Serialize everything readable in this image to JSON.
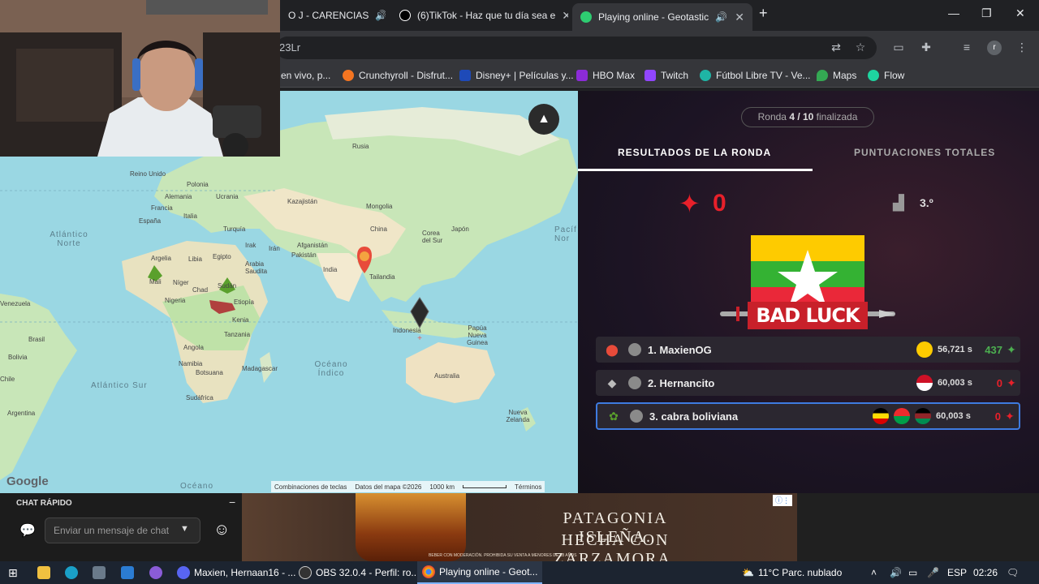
{
  "browser": {
    "tabs": [
      {
        "title": "O J - CARENCIAS",
        "icon": "youtube-tab-icon"
      },
      {
        "title": "(6)TikTok - Haz que tu día sea e",
        "icon": "tiktok-icon"
      },
      {
        "title": "Playing online - Geotastic",
        "icon": "geotastic-icon"
      }
    ],
    "new_tab": "+",
    "url": "23Lr",
    "bookmarks": [
      "en vivo, p...",
      "Crunchyroll - Disfrut...",
      "Disney+ | Películas y...",
      "HBO Max",
      "Twitch",
      "Fútbol Libre TV - Ve...",
      "Maps",
      "Flow"
    ],
    "bookmark_colors": [
      "#777777",
      "#f47521",
      "#1e4ab8",
      "#8c2bd8",
      "#9146ff",
      "#1fb5a5",
      "#34a853",
      "#1ed5a0"
    ]
  },
  "map": {
    "countries": [
      "Rusia",
      "Reino Unido",
      "Polonia",
      "Alemania",
      "Ucrania",
      "Francia",
      "España",
      "Italia",
      "Kazajistán",
      "Mongolia",
      "Turquía",
      "Irak",
      "Irán",
      "China",
      "Corea del Sur",
      "Japón",
      "Afganistán",
      "Pakistán",
      "India",
      "Arabia Saudita",
      "Argelia",
      "Libia",
      "Egipto",
      "Mali",
      "Níger",
      "Chad",
      "Sudán",
      "Nigeria",
      "Etiopía",
      "Kenia",
      "Tanzania",
      "Angola",
      "Namibia",
      "Botsuana",
      "Madagascar",
      "Sudáfrica",
      "Venezuela",
      "Brasil",
      "Bolivia",
      "Chile",
      "Argentina",
      "Indonesia",
      "Papúa Nueva Guinea",
      "Australia",
      "Nueva Zelanda",
      "Tailandia"
    ],
    "oceans": [
      "Atlántico Norte",
      "Atlántico Sur",
      "Océano Índico",
      "Océano",
      "Pacíf Nor"
    ],
    "footer": [
      "Combinaciones de teclas",
      "Datos del mapa ©2026",
      "1000 km",
      "Términos"
    ],
    "logo": "Google"
  },
  "game": {
    "round_prefix": "Ronda ",
    "round_bold": "4 / 10",
    "round_suffix": " finalizada",
    "tabs": [
      "RESULTADOS DE LA RONDA",
      "PUNTUACIONES TOTALES"
    ],
    "score": "0",
    "rank": "3.º",
    "banner": "BAD LUCK",
    "players": [
      {
        "name": "1. MaxienOG",
        "time": "56,721 s",
        "points": "437",
        "points_color": "#4caf50",
        "flags": [
          "#fecb00"
        ]
      },
      {
        "name": "2. Hernancito",
        "time": "60,003 s",
        "points": "0",
        "points_color": "#e8202a",
        "flags": [
          "#ce1126"
        ]
      },
      {
        "name": "3. cabra boliviana",
        "time": "60,003 s",
        "points": "0",
        "points_color": "#e8202a",
        "flags": [
          "#fcdc04",
          "#009e49",
          "#922529"
        ]
      }
    ]
  },
  "chat": {
    "title": "CHAT RÁPIDO",
    "placeholder": "Enviar un mensaje de chat",
    "minimize": "−"
  },
  "ad": {
    "line1": "PATAGONIA ISLEÑA.",
    "line2": "HECHA CON ZARZAMORA.",
    "disclaimer": "BEBER CON MODERACIÓN. PROHIBIDA SU VENTA A MENORES DE 18 AÑOS"
  },
  "taskbar": {
    "apps": [
      "Maxien, Hernaan16 - ...",
      "OBS 32.0.4 - Perfil: ro...",
      "Playing online - Geot..."
    ],
    "weather": "11°C  Parc. nublado",
    "lang": "ESP",
    "time": "02:26"
  }
}
